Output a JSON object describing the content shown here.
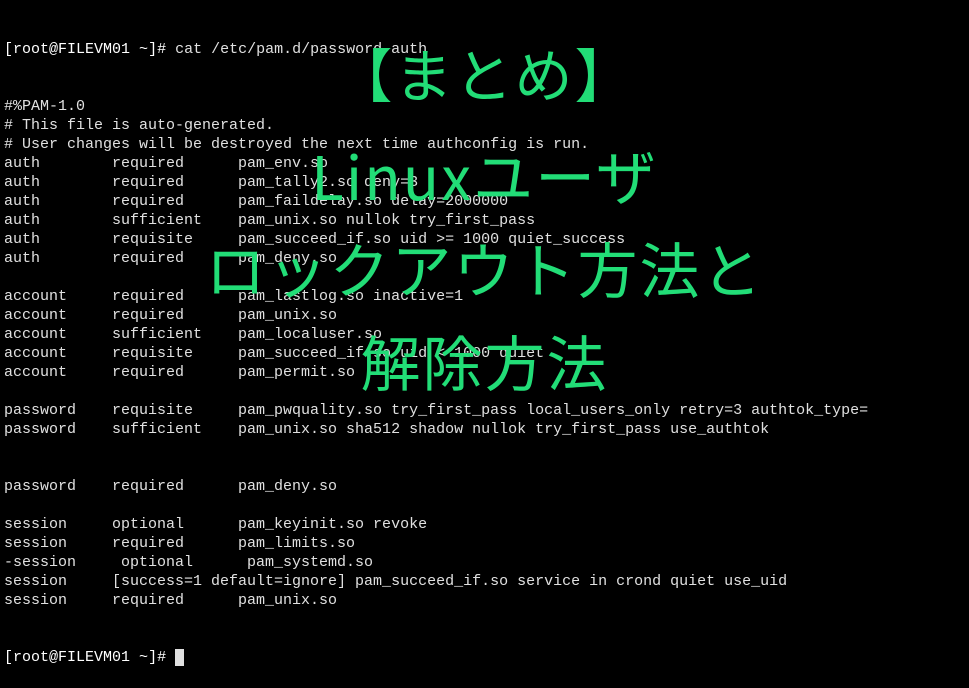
{
  "prompt": {
    "open": "[",
    "userhost": "root@FILEVM01",
    "path": " ~",
    "close": "]",
    "hash": "# "
  },
  "command": "cat /etc/pam.d/password-auth",
  "output_lines": [
    "#%PAM-1.0",
    "# This file is auto-generated.",
    "# User changes will be destroyed the next time authconfig is run.",
    "auth        required      pam_env.so",
    "auth        required      pam_tally2.so deny=3",
    "auth        required      pam_faildelay.so delay=2000000",
    "auth        sufficient    pam_unix.so nullok try_first_pass",
    "auth        requisite     pam_succeed_if.so uid >= 1000 quiet_success",
    "auth        required      pam_deny.so",
    "",
    "account     required      pam_lastlog.so inactive=1",
    "account     required      pam_unix.so",
    "account     sufficient    pam_localuser.so",
    "account     requisite     pam_succeed_if.so uid < 1000 quiet",
    "account     required      pam_permit.so",
    "",
    "password    requisite     pam_pwquality.so try_first_pass local_users_only retry=3 authtok_type=",
    "password    sufficient    pam_unix.so sha512 shadow nullok try_first_pass use_authtok",
    "",
    "",
    "password    required      pam_deny.so",
    "",
    "session     optional      pam_keyinit.so revoke",
    "session     required      pam_limits.so",
    "-session     optional      pam_systemd.so",
    "session     [success=1 default=ignore] pam_succeed_if.so service in crond quiet use_uid",
    "session     required      pam_unix.so"
  ],
  "overlay": {
    "line0": "【まとめ】",
    "line1": "Linuxユーザ",
    "line2": "ロックアウト方法と",
    "line3": "解除方法"
  }
}
